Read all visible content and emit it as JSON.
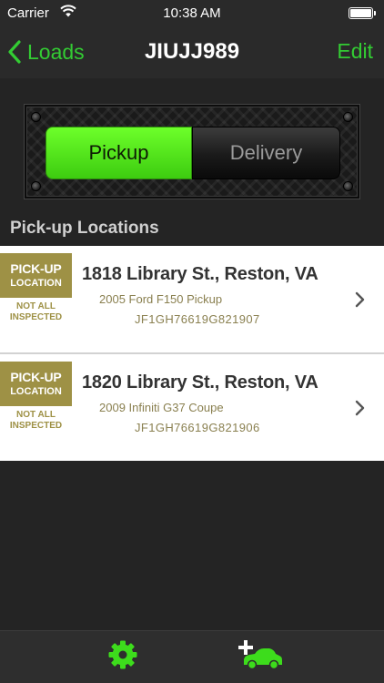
{
  "status_bar": {
    "carrier": "Carrier",
    "time": "10:38 AM"
  },
  "nav": {
    "back_label": "Loads",
    "title": "JIUJJ989",
    "edit_label": "Edit"
  },
  "segments": {
    "pickup_label": "Pickup",
    "delivery_label": "Delivery",
    "selected": "Pickup"
  },
  "section_header": "Pick-up Locations",
  "locations": [
    {
      "badge_top": "PICK-UP",
      "badge_bottom": "LOCATION",
      "status_line1": "NOT ALL",
      "status_line2": "INSPECTED",
      "address": "1818 Library St., Reston, VA",
      "vehicle": "2005 Ford F150 Pickup",
      "vin": "JF1GH76619G821907"
    },
    {
      "badge_top": "PICK-UP",
      "badge_bottom": "LOCATION",
      "status_line1": "NOT ALL",
      "status_line2": "INSPECTED",
      "address": "1820 Library St., Reston, VA",
      "vehicle": "2009 Infiniti G37 Coupe",
      "vin": "JF1GH76619G821906"
    }
  ],
  "tab_bar": {
    "items": [
      {
        "icon": "gear-icon"
      },
      {
        "icon": "add-vehicle-icon"
      }
    ]
  },
  "colors": {
    "accent_green": "#33cc33",
    "segment_green": "#4ee01a",
    "badge_gold": "#9e9145",
    "background": "#242424"
  }
}
